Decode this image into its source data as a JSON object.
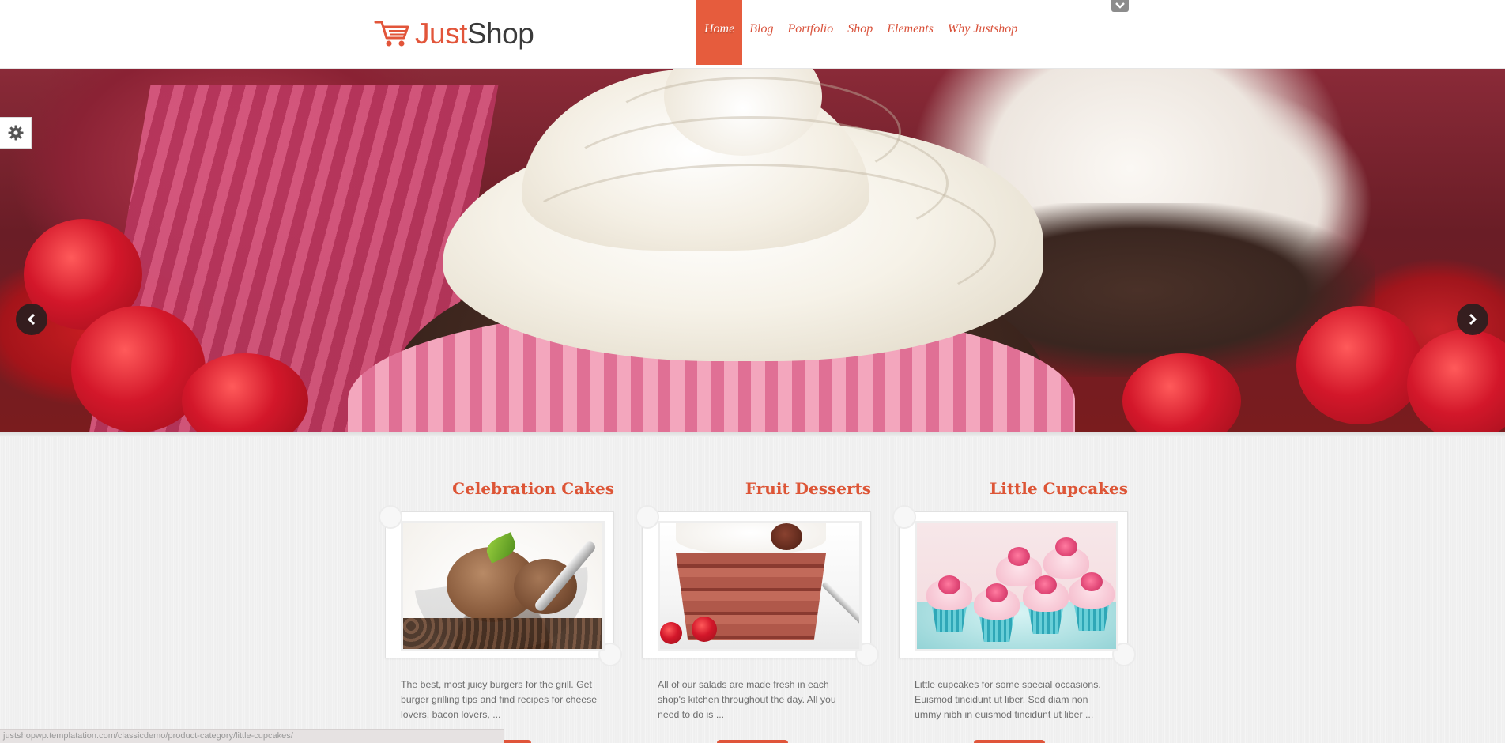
{
  "brand": {
    "name_part1": "Just",
    "name_part2": "Shop",
    "accent": "#e65c3d",
    "text_dark": "#3a3a3a"
  },
  "nav": {
    "items": [
      {
        "label": "Home",
        "active": true
      },
      {
        "label": "Blog",
        "active": false
      },
      {
        "label": "Portfolio",
        "active": false
      },
      {
        "label": "Shop",
        "active": false
      },
      {
        "label": "Elements",
        "active": false
      },
      {
        "label": "Why Justshop",
        "active": false
      }
    ],
    "toggle_icon": "chevron-down-icon"
  },
  "slider": {
    "prev_icon": "chevron-left-icon",
    "next_icon": "chevron-right-icon",
    "settings_icon": "gear-icon"
  },
  "categories": [
    {
      "title": "Celebration Cakes",
      "text": "The best, most juicy burgers for the grill. Get burger grilling tips and find recipes for cheese lovers, bacon lovers, ..."
    },
    {
      "title": "Fruit Desserts",
      "text": "All of our salads are made fresh in each shop's kitchen throughout the day. All you need to do is ..."
    },
    {
      "title": "Little Cupcakes",
      "text": "Little cupcakes for some special occasions. Euismod tincidunt ut liber. Sed diam non ummy nibh in euismod tincidunt ut liber ..."
    }
  ],
  "status_bar": {
    "url": "justshopwp.templatation.com/classicdemo/product-category/little-cupcakes/"
  }
}
